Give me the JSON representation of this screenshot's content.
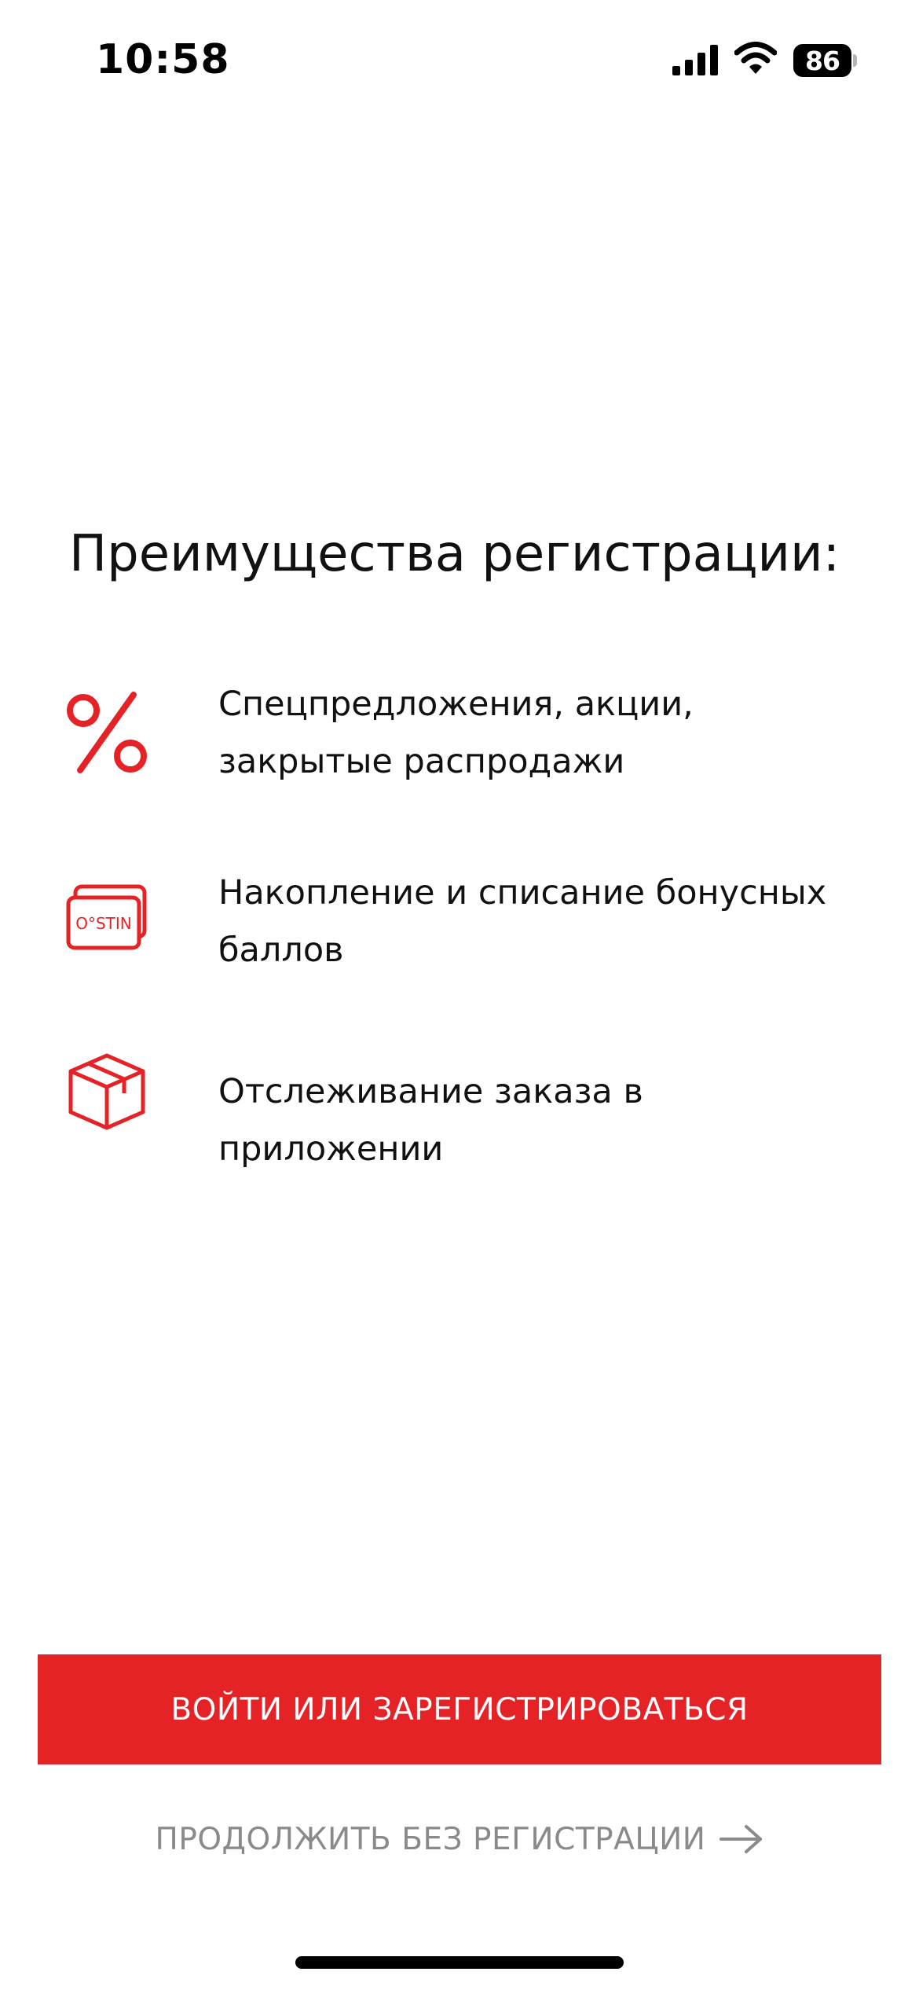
{
  "status_bar": {
    "time": "10:58",
    "battery": "86",
    "icons": [
      "cellular-signal-icon",
      "wifi-icon",
      "battery-icon"
    ]
  },
  "title": "Преимущества регистрации:",
  "benefits": [
    {
      "icon": "percent-icon",
      "text": "Спецпредложения, акции, закрытые распродажи"
    },
    {
      "icon": "bonus-card-icon",
      "text": "Накопление и списание бонусных баллов",
      "card_label": "O°STIN"
    },
    {
      "icon": "box-icon",
      "text": "Отслеживание заказа в приложении"
    }
  ],
  "buttons": {
    "primary_label": "ВОЙТИ ИЛИ ЗАРЕГИСТРИРОВАТЬСЯ",
    "secondary_label": "ПРОДОЛЖИТЬ БЕЗ РЕГИСТРАЦИИ"
  },
  "colors": {
    "accent": "#e52327",
    "text": "#111111",
    "muted": "#8a8a8a",
    "background": "#ffffff"
  }
}
